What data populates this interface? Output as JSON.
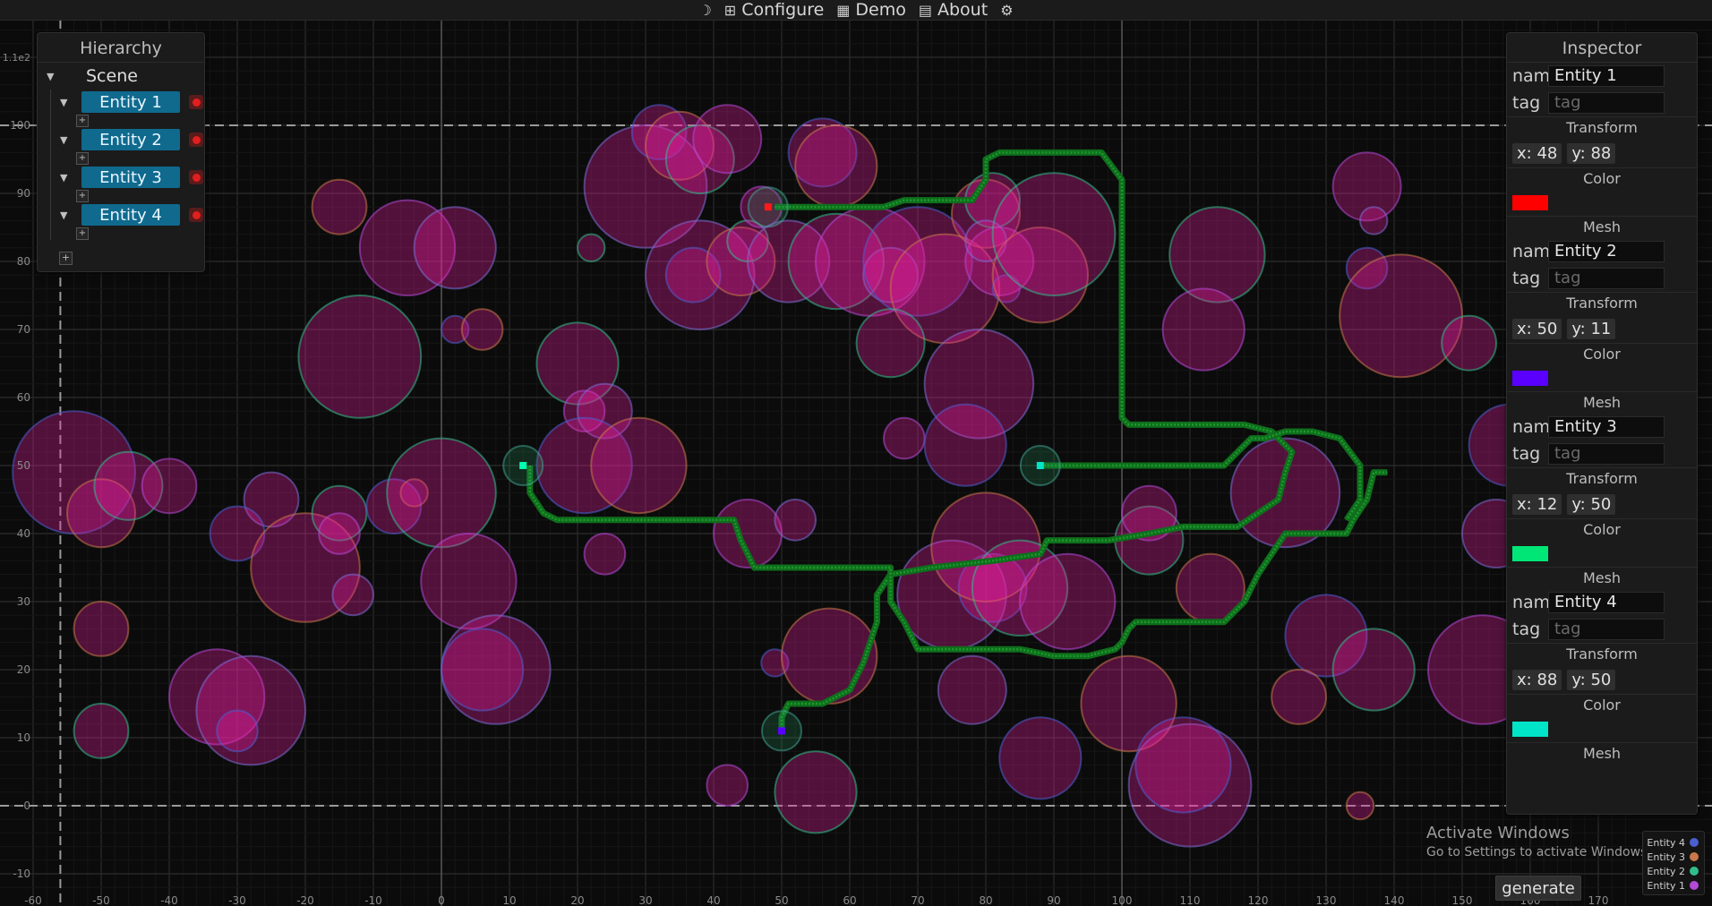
{
  "menu": {
    "theme_icon": "moon-icon",
    "items": [
      {
        "icon": "hierarchy-icon",
        "label": "Configure"
      },
      {
        "icon": "demo-icon",
        "label": "Demo"
      },
      {
        "icon": "book-icon",
        "label": "About"
      }
    ],
    "settings_icon": "gear-icon"
  },
  "hierarchy": {
    "title": "Hierarchy",
    "scene_label": "Scene",
    "entities": [
      "Entity 1",
      "Entity 2",
      "Entity 3",
      "Entity 4"
    ],
    "add_label": "+"
  },
  "inspector": {
    "title": "Inspector",
    "name_label": "name",
    "tag_label": "tag",
    "tag_placeholder": "tag",
    "transform_label": "Transform",
    "color_label": "Color",
    "mesh_label": "Mesh",
    "entities": [
      {
        "name": "Entity 1",
        "x": "x: 48",
        "y": "y: 88",
        "color": "#ff0000"
      },
      {
        "name": "Entity 2",
        "x": "x: 50",
        "y": "y: 11",
        "color": "#5a00ff"
      },
      {
        "name": "Entity 3",
        "x": "x: 12",
        "y": "y: 50",
        "color": "#00e676"
      },
      {
        "name": "Entity 4",
        "x": "x: 88",
        "y": "y: 50",
        "color": "#00e5c8"
      }
    ]
  },
  "watermark": {
    "line1": "Activate Windows",
    "line2": "Go to Settings to activate Windows."
  },
  "generate_label": "generate",
  "legend": [
    {
      "name": "Entity 4",
      "color": "#4a5fd0"
    },
    {
      "name": "Entity 3",
      "color": "#c8784a"
    },
    {
      "name": "Entity 2",
      "color": "#2fbf8a"
    },
    {
      "name": "Entity 1",
      "color": "#b34bd6"
    }
  ],
  "chart_data": {
    "type": "scatter",
    "x_ticks": [
      "-60",
      "-50",
      "-40",
      "-30",
      "-20",
      "-10",
      "0",
      "10",
      "20",
      "30",
      "40",
      "50",
      "60",
      "70",
      "80",
      "90",
      "100",
      "110",
      "120",
      "130",
      "140",
      "150",
      "160",
      "170"
    ],
    "y_ticks": [
      "-10",
      "0",
      "10",
      "20",
      "30",
      "40",
      "50",
      "60",
      "70",
      "80",
      "90",
      "100"
    ],
    "y_exponent_label": "1.1e2",
    "xlim": [
      -60,
      175
    ],
    "ylim": [
      -12,
      115
    ],
    "grid": true,
    "obstacles": [
      [
        -54,
        49,
        9
      ],
      [
        -50,
        43,
        5
      ],
      [
        -46,
        47,
        5
      ],
      [
        -40,
        47,
        4
      ],
      [
        -25,
        45,
        4
      ],
      [
        -30,
        40,
        4
      ],
      [
        -20,
        35,
        8
      ],
      [
        -15,
        43,
        4
      ],
      [
        -15,
        40,
        3
      ],
      [
        -13,
        31,
        3
      ],
      [
        -7,
        44,
        4
      ],
      [
        -4,
        46,
        2
      ],
      [
        0,
        46,
        8
      ],
      [
        4,
        33,
        7
      ],
      [
        8,
        20,
        8
      ],
      [
        6,
        20,
        6
      ],
      [
        -50,
        26,
        4
      ],
      [
        -50,
        11,
        4
      ],
      [
        -33,
        16,
        7
      ],
      [
        -28,
        14,
        8
      ],
      [
        -30,
        11,
        3
      ],
      [
        -15,
        88,
        4
      ],
      [
        -12,
        66,
        9
      ],
      [
        -5,
        82,
        7
      ],
      [
        2,
        82,
        6
      ],
      [
        2,
        70,
        2
      ],
      [
        6,
        70,
        3
      ],
      [
        20,
        65,
        6
      ],
      [
        21,
        58,
        3
      ],
      [
        24,
        58,
        4
      ],
      [
        21,
        50,
        7
      ],
      [
        29,
        50,
        7
      ],
      [
        22,
        82,
        2
      ],
      [
        24,
        37,
        3
      ],
      [
        30,
        91,
        9
      ],
      [
        32,
        99,
        4
      ],
      [
        35,
        97,
        5
      ],
      [
        38,
        95,
        5
      ],
      [
        42,
        98,
        5
      ],
      [
        38,
        78,
        8
      ],
      [
        37,
        78,
        4
      ],
      [
        44,
        80,
        5
      ],
      [
        45,
        83,
        3
      ],
      [
        47,
        88,
        3
      ],
      [
        51,
        80,
        6
      ],
      [
        56,
        96,
        5
      ],
      [
        58,
        94,
        6
      ],
      [
        58,
        80,
        7
      ],
      [
        63,
        80,
        8
      ],
      [
        66,
        78,
        4
      ],
      [
        70,
        80,
        8
      ],
      [
        74,
        76,
        8
      ],
      [
        66,
        68,
        5
      ],
      [
        68,
        54,
        3
      ],
      [
        79,
        62,
        8
      ],
      [
        77,
        53,
        6
      ],
      [
        80,
        87,
        5
      ],
      [
        81,
        89,
        4
      ],
      [
        82,
        80,
        5
      ],
      [
        80,
        83,
        3
      ],
      [
        83,
        76,
        2
      ],
      [
        88,
        78,
        7
      ],
      [
        90,
        84,
        9
      ],
      [
        45,
        40,
        5
      ],
      [
        52,
        42,
        3
      ],
      [
        49,
        21,
        2
      ],
      [
        57,
        22,
        7
      ],
      [
        55,
        2,
        6
      ],
      [
        42,
        3,
        3
      ],
      [
        75,
        31,
        8
      ],
      [
        81,
        32,
        5
      ],
      [
        80,
        38,
        8
      ],
      [
        85,
        32,
        7
      ],
      [
        92,
        30,
        7
      ],
      [
        78,
        17,
        5
      ],
      [
        88,
        7,
        6
      ],
      [
        101,
        15,
        7
      ],
      [
        104,
        39,
        5
      ],
      [
        104,
        43,
        4
      ],
      [
        110,
        3,
        9
      ],
      [
        109,
        6,
        7
      ],
      [
        113,
        32,
        5
      ],
      [
        114,
        81,
        7
      ],
      [
        112,
        70,
        6
      ],
      [
        124,
        46,
        8
      ],
      [
        130,
        25,
        6
      ],
      [
        126,
        16,
        4
      ],
      [
        137,
        20,
        6
      ],
      [
        136,
        91,
        5
      ],
      [
        137,
        86,
        2
      ],
      [
        136,
        79,
        3
      ],
      [
        141,
        72,
        9
      ],
      [
        151,
        68,
        4
      ],
      [
        153,
        20,
        8
      ],
      [
        155,
        40,
        5
      ],
      [
        157,
        53,
        6
      ],
      [
        135,
        0,
        2
      ]
    ],
    "paths": [
      {
        "name": "Entity 1",
        "points": [
          [
            49,
            88
          ],
          [
            65,
            88
          ],
          [
            68,
            89
          ],
          [
            78,
            89
          ],
          [
            80,
            92
          ],
          [
            80,
            95
          ],
          [
            82,
            96
          ],
          [
            97,
            96
          ],
          [
            100,
            92
          ],
          [
            100,
            57
          ],
          [
            101,
            56
          ],
          [
            118,
            56
          ],
          [
            122,
            55
          ],
          [
            125,
            52
          ],
          [
            124,
            49
          ],
          [
            123,
            45
          ],
          [
            120,
            43
          ],
          [
            117,
            41
          ],
          [
            109,
            41
          ],
          [
            104,
            40
          ],
          [
            98,
            39
          ],
          [
            89,
            39
          ],
          [
            88,
            37
          ],
          [
            81,
            36
          ],
          [
            72,
            35
          ],
          [
            66,
            34
          ],
          [
            64,
            31
          ],
          [
            64,
            27
          ],
          [
            63,
            24
          ],
          [
            62,
            21
          ],
          [
            60,
            17
          ],
          [
            56,
            15
          ],
          [
            51,
            15
          ],
          [
            50,
            13
          ],
          [
            50,
            11
          ]
        ]
      },
      {
        "name": "Entity 3",
        "points": [
          [
            13,
            50
          ],
          [
            13,
            46
          ],
          [
            15,
            43
          ],
          [
            17,
            42
          ],
          [
            43,
            42
          ],
          [
            44,
            39
          ],
          [
            45,
            37
          ],
          [
            46,
            35
          ],
          [
            66,
            35
          ],
          [
            66,
            30
          ],
          [
            68,
            27
          ],
          [
            70,
            23
          ],
          [
            85,
            23
          ],
          [
            90,
            22
          ],
          [
            95,
            22
          ],
          [
            99,
            23
          ],
          [
            100,
            24
          ],
          [
            101,
            26
          ],
          [
            102,
            27
          ],
          [
            115,
            27
          ],
          [
            118,
            30
          ],
          [
            120,
            34
          ],
          [
            122,
            37
          ],
          [
            124,
            40
          ],
          [
            128,
            40
          ],
          [
            133,
            40
          ],
          [
            134,
            42
          ],
          [
            136,
            45
          ],
          [
            137,
            49
          ],
          [
            139,
            49
          ]
        ]
      },
      {
        "name": "Entity 4",
        "points": [
          [
            88,
            50
          ],
          [
            115,
            50
          ],
          [
            117,
            52
          ],
          [
            119,
            54
          ],
          [
            121,
            54
          ],
          [
            124,
            55
          ],
          [
            128,
            55
          ],
          [
            132,
            54
          ],
          [
            135,
            50
          ],
          [
            135,
            45
          ],
          [
            133,
            42
          ]
        ]
      }
    ],
    "markers": [
      {
        "name": "Entity 1",
        "x": 48,
        "y": 88,
        "color": "#ff1a1a"
      },
      {
        "name": "Entity 2",
        "x": 50,
        "y": 11,
        "color": "#5a00ff"
      },
      {
        "name": "Entity 3",
        "x": 12,
        "y": 50,
        "color": "#00ffb0"
      },
      {
        "name": "Entity 4",
        "x": 88,
        "y": 50,
        "color": "#00e5c8"
      }
    ]
  }
}
